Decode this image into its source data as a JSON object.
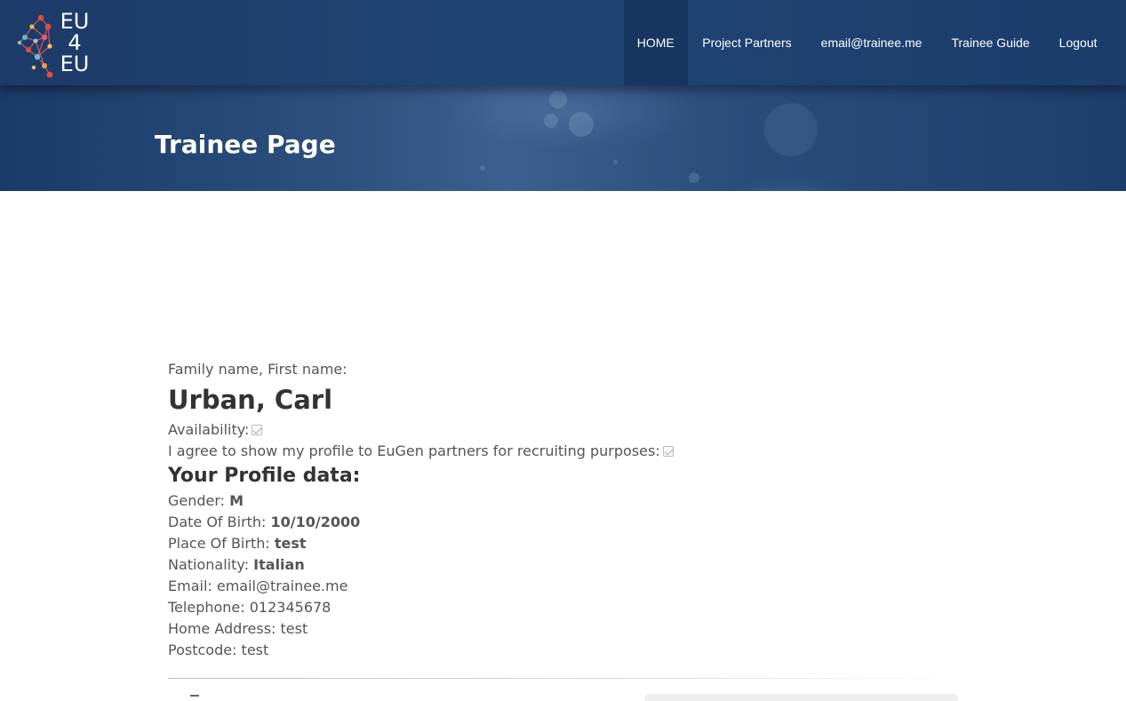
{
  "logo": {
    "line1": "EU",
    "line2": "4",
    "line3": "EU",
    "icon": "network-molecule-icon"
  },
  "nav": {
    "items": [
      {
        "label": "HOME",
        "active": true
      },
      {
        "label": "Project Partners",
        "active": false
      },
      {
        "label": "email@trainee.me",
        "active": false
      },
      {
        "label": "Trainee Guide",
        "active": false
      },
      {
        "label": "Logout",
        "active": false
      }
    ]
  },
  "hero": {
    "title": "Trainee Page"
  },
  "profile": {
    "name_label": "Family name, First name:",
    "name": "Urban, Carl",
    "availability_label": "Availability:",
    "availability_checked": true,
    "consent_label": "I agree to show my profile to EuGen partners for recruiting purposes:",
    "consent_checked": true,
    "section_title": "Your Profile data:",
    "fields": [
      {
        "label": "Gender: ",
        "value": "M",
        "bold": true
      },
      {
        "label": "Date Of Birth: ",
        "value": "10/10/2000",
        "bold": true
      },
      {
        "label": "Place Of Birth: ",
        "value": "test",
        "bold": true
      },
      {
        "label": "Nationality: ",
        "value": "Italian",
        "bold": true
      },
      {
        "label": "Email: ",
        "value": "email@trainee.me",
        "bold": false
      },
      {
        "label": "Telephone: ",
        "value": "012345678",
        "bold": false
      },
      {
        "label": "Home Address: ",
        "value": "test",
        "bold": false
      },
      {
        "label": "Postcode: ",
        "value": "test",
        "bold": false
      }
    ]
  },
  "colors": {
    "header": "#1f4474",
    "text": "#555555",
    "heading": "#333333"
  }
}
